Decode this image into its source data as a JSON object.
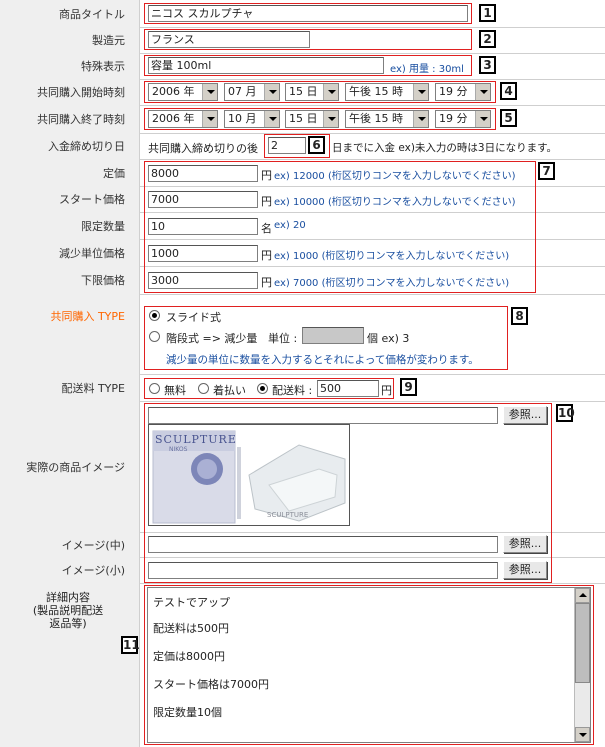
{
  "labels": {
    "title": "商品タイトル",
    "maker": "製造元",
    "special": "特殊表示",
    "start_time": "共同購入開始時刻",
    "end_time": "共同購入終了時刻",
    "deadline": "入金締め切り日",
    "list_price": "定価",
    "start_price": "スタート価格",
    "limit_qty": "限定数量",
    "decrease_unit": "減少単位価格",
    "lower_limit": "下限価格",
    "type": "共同購入 TYPE",
    "shipping_type": "配送料 TYPE",
    "image": "実際の商品イメージ",
    "image_mid": "イメージ(中)",
    "image_small": "イメージ(小)",
    "detail_1": "詳細内容",
    "detail_2": "(製品説明配送",
    "detail_3": "返品等)"
  },
  "values": {
    "title": "ニコス スカルプチャ",
    "maker": "フランス",
    "special": "容量 100ml",
    "special_hint": "ex) 用量 : 30ml",
    "deadline_prefix": "共同購入締め切りの後",
    "deadline_value": "2",
    "deadline_suffix": "日までに入金 ex)未入力の時は3日になります。",
    "list_price": "8000",
    "list_price_hint": "ex) 12000 (桁区切りコンマを入力しないでください)",
    "start_price": "7000",
    "start_price_hint": "ex) 10000 (桁区切りコンマを入力しないでください)",
    "limit_qty": "10",
    "limit_qty_hint": "ex) 20",
    "decrease_unit": "1000",
    "decrease_unit_hint": "ex) 1000 (桁区切りコンマを入力しないでください)",
    "lower_limit": "3000",
    "lower_limit_hint": "ex) 7000 (桁区切りコンマを入力しないでください)",
    "yen": "円",
    "mei": "名"
  },
  "start": {
    "year": "2006 年",
    "month": "07 月",
    "day": "15 日",
    "hour": "午後 15 時",
    "minute": "19 分"
  },
  "end": {
    "year": "2006 年",
    "month": "10 月",
    "day": "15 日",
    "hour": "午後 15 時",
    "minute": "19 分"
  },
  "type": {
    "slide": "スライド式",
    "step": "階段式 => 減少量",
    "unit_label": "単位 :",
    "unit_suffix": "個 ex) 3",
    "note": "減少量の単位に数量を入力するとそれによって価格が変わります。",
    "selected": "slide"
  },
  "shipping": {
    "free": "無料",
    "cod": "着払い",
    "paid": "配送料 :",
    "amount": "500",
    "yen": "円",
    "selected": "paid"
  },
  "image": {
    "browse": "参照...",
    "product_text": "SCULPTURE",
    "product_subtext": "NIKOS",
    "product_bottom": "SCULPTURE"
  },
  "detail": {
    "lines": [
      "テストでアップ",
      "配送料は500円",
      "定価は8000円",
      "スタート価格は7000円",
      "限定数量10個"
    ]
  },
  "markers": [
    "1",
    "2",
    "3",
    "4",
    "5",
    "6",
    "7",
    "8",
    "9",
    "10",
    "11"
  ]
}
